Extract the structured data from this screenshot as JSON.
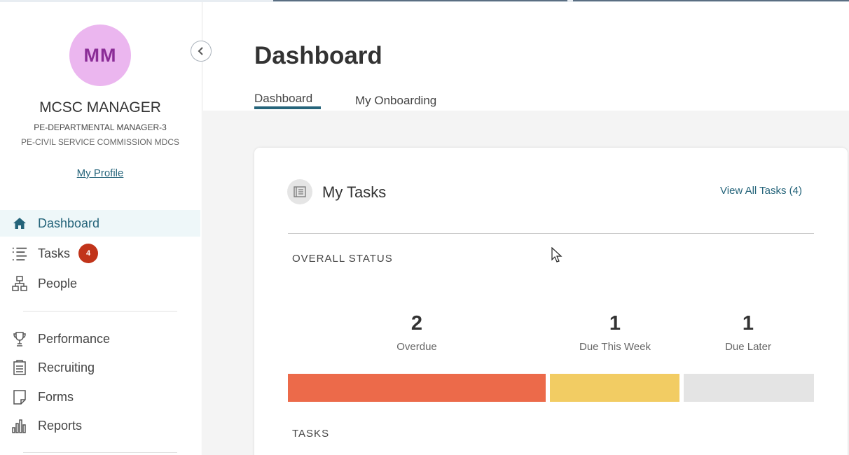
{
  "user": {
    "initials": "MM",
    "name": "MCSC MANAGER",
    "role": "PE-DEPARTMENTAL MANAGER-3",
    "org": "PE-CIVIL SERVICE COMMISSION MDCS",
    "profile_link": "My Profile"
  },
  "sidebar": {
    "items": [
      {
        "label": "Dashboard",
        "icon": "home-icon",
        "active": true
      },
      {
        "label": "Tasks",
        "icon": "list-icon",
        "badge": "4"
      },
      {
        "label": "People",
        "icon": "org-chart-icon"
      },
      {
        "label": "Performance",
        "icon": "trophy-icon"
      },
      {
        "label": "Recruiting",
        "icon": "clipboard-icon"
      },
      {
        "label": "Forms",
        "icon": "document-icon"
      },
      {
        "label": "Reports",
        "icon": "bar-chart-icon"
      }
    ]
  },
  "page": {
    "title": "Dashboard",
    "tabs": [
      {
        "label": "Dashboard",
        "active": true
      },
      {
        "label": "My Onboarding",
        "active": false
      }
    ]
  },
  "tasks_card": {
    "title": "My Tasks",
    "view_all": "View All Tasks (4)",
    "overall_label": "OVERALL STATUS",
    "tasks_label": "TASKS",
    "stats": [
      {
        "value": "2",
        "label": "Overdue",
        "color": "#ec6a4a"
      },
      {
        "value": "1",
        "label": "Due This Week",
        "color": "#f2cc63"
      },
      {
        "value": "1",
        "label": "Due Later",
        "color": "#e4e4e4"
      }
    ]
  },
  "colors": {
    "accent": "#25647a",
    "badge": "#c1341a",
    "avatar_bg": "#ebb6ef",
    "avatar_text": "#8b2d97"
  }
}
